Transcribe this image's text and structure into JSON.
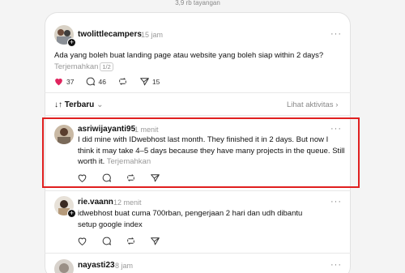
{
  "top": {
    "views": "3,9 rb tayangan"
  },
  "post": {
    "username": "twolittlecampers",
    "time": "15 jam",
    "more": "···",
    "text": "Ada yang boleh buat landing page atau website yang boleh siap within 2 days?",
    "translate": "Terjemahkan",
    "translate_badge": "1/2",
    "likes": "37",
    "replies": "46",
    "shares": "15",
    "like_color": "#e0245e"
  },
  "sort": {
    "label": "Terbaru",
    "activity": "Lihat aktivitas"
  },
  "replies": [
    {
      "username": "asriwijayanti95",
      "time": "1 menit",
      "more": "···",
      "text": "I did mine with IDwebhost last month. They finished it in 2 days. But now I think it may take 4–5 days because they have many projects in the queue. Still worth it.",
      "translate": "Terjemahkan"
    },
    {
      "username": "rie.vaann",
      "time": "12 menit",
      "more": "···",
      "text": "idwebhost buat cuma 700rban, pengerjaan 2 hari dan udh dibantu setup google index"
    },
    {
      "username": "nayasti23",
      "time": "8 jam",
      "more": "···"
    }
  ],
  "colors": {
    "highlight": "#e02020"
  }
}
